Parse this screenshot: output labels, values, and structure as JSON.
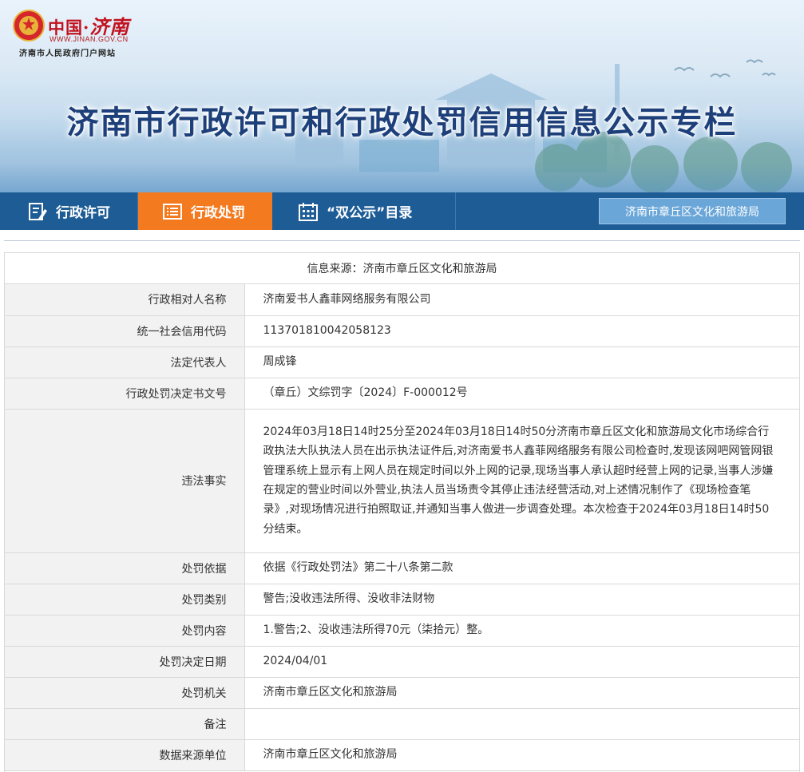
{
  "site": {
    "logo_main": "中国·",
    "logo_script": "济南",
    "logo_url": "WWW.JINAN.GOV.CN",
    "logo_subtitle": "济南市人民政府门户网站",
    "banner_title": "济南市行政许可和行政处罚信用信息公示专栏"
  },
  "nav": {
    "items": [
      {
        "label": "行政许可",
        "icon": "document-edit-icon",
        "active": false
      },
      {
        "label": "行政处罚",
        "icon": "list-icon",
        "active": true
      },
      {
        "label": "“双公示”目录",
        "icon": "calendar-icon",
        "active": false
      }
    ],
    "source_button": "济南市章丘区文化和旅游局"
  },
  "colors": {
    "nav_bg": "#1e5c96",
    "nav_active": "#f47a20",
    "title_color": "#1d3f7a",
    "label_bg": "#f2f2f2"
  },
  "info": {
    "source_line": "信息来源：济南市章丘区文化和旅游局",
    "rows": [
      {
        "label": "行政相对人名称",
        "value": "济南爱书人鑫菲网络服务有限公司"
      },
      {
        "label": "统一社会信用代码",
        "value": "113701810042058123"
      },
      {
        "label": "法定代表人",
        "value": "周成锋"
      },
      {
        "label": "行政处罚决定书文号",
        "value": "（章丘）文综罚字〔2024〕F-000012号"
      },
      {
        "label": "违法事实",
        "value": "2024年03月18日14时25分至2024年03月18日14时50分济南市章丘区文化和旅游局文化市场综合行政执法大队执法人员在出示执法证件后,对济南爱书人鑫菲网络服务有限公司检查时,发现该网吧网管网银管理系统上显示有上网人员在规定时间以外上网的记录,现场当事人承认超时经营上网的记录,当事人涉嫌在规定的营业时间以外营业,执法人员当场责令其停止违法经营活动,对上述情况制作了《现场检查笔录》,对现场情况进行拍照取证,并通知当事人做进一步调查处理。本次检查于2024年03月18日14时50分结束。"
      },
      {
        "label": "处罚依据",
        "value": "依据《行政处罚法》第二十八条第二款"
      },
      {
        "label": "处罚类别",
        "value": "警告;没收违法所得、没收非法财物"
      },
      {
        "label": "处罚内容",
        "value": "1.警告;2、没收违法所得70元（柒拾元）整。"
      },
      {
        "label": "处罚决定日期",
        "value": "2024/04/01"
      },
      {
        "label": "处罚机关",
        "value": "济南市章丘区文化和旅游局"
      },
      {
        "label": "备注",
        "value": ""
      },
      {
        "label": "数据来源单位",
        "value": "济南市章丘区文化和旅游局"
      }
    ]
  }
}
